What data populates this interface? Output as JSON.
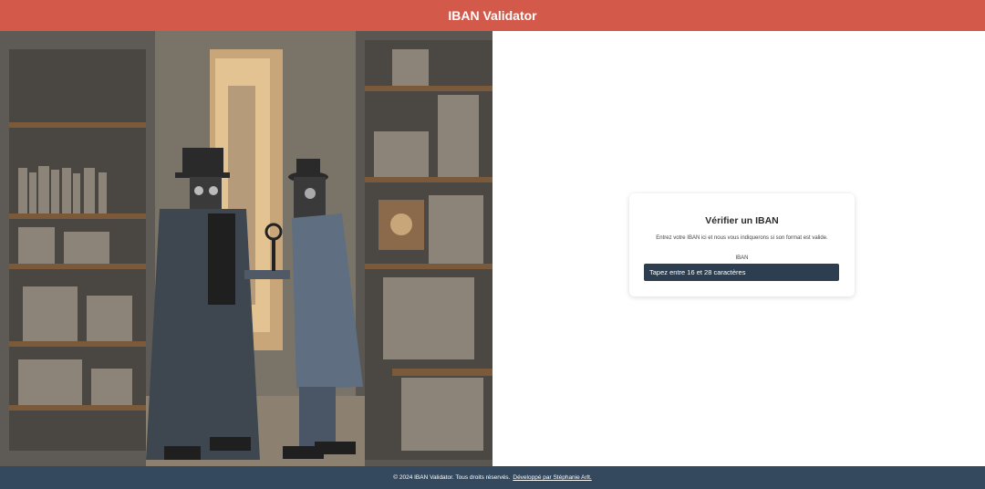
{
  "header": {
    "title": "IBAN Validator"
  },
  "hero": {
    "image_description_icon": "robots-in-workshop-illustration"
  },
  "card": {
    "title": "Vérifier un IBAN",
    "description": "Entrez votre IBAN ici et nous vous indiquerons si son format est valide.",
    "iban_label": "IBAN",
    "iban_placeholder": "Tapez entre 16 et 28 caractères",
    "iban_value": ""
  },
  "footer": {
    "copyright": "© 2024 IBAN Validator. Tous droits réservés.",
    "link_text": "Développé par Stéphanie Arlt."
  },
  "colors": {
    "header_bg": "#d35a4b",
    "footer_bg": "#34495e",
    "input_bg": "#2c3e50"
  }
}
